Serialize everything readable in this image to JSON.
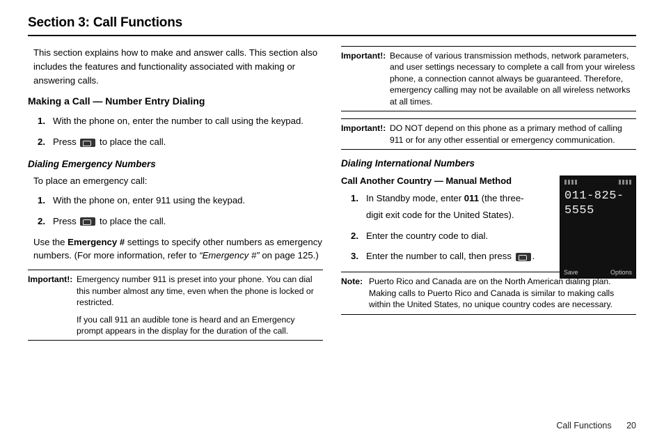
{
  "section_title": "Section 3: Call Functions",
  "intro": "This section explains how to make and answer calls. This section also includes the features and functionality associated with making or answering calls.",
  "left": {
    "h2": "Making a Call — Number Entry Dialing",
    "steps1": [
      "With the phone on, enter the number to call using the keypad.",
      "Press [SEND] to place the call."
    ],
    "h3": "Dialing Emergency Numbers",
    "p1": "To place an emergency call:",
    "steps2": [
      "With the phone on, enter 911 using the keypad.",
      "Press [SEND] to place the call."
    ],
    "p2a": "Use the ",
    "p2b": "Emergency #",
    "p2c": " settings to specify other numbers as emergency numbers. (For more information, refer to ",
    "p2d": "“Emergency #”",
    "p2e": " on page 125.)",
    "note1_label": "Important!:",
    "note1_body": "Emergency number 911 is preset into your phone. You can dial this number almost any time, even when the phone is locked or restricted.",
    "note1_extra": "If you call 911 an audible tone is heard and an Emergency prompt appears in the display for the duration of the call."
  },
  "right": {
    "note2_label": "Important!:",
    "note2_body": "Because of various transmission methods, network parameters, and user settings necessary to complete a call from your wireless phone, a connection cannot always be guaranteed. Therefore, emergency calling may not be available on all wireless networks at all times.",
    "note3_label": "Important!:",
    "note3_body": "DO NOT depend on this phone as a primary method of calling 911 or for any other essential or emergency communication.",
    "h3": "Dialing International Numbers",
    "h4": "Call Another Country — Manual Method",
    "intl_steps": [
      {
        "pre": "In Standby mode, enter ",
        "bold": "011",
        "post": " (the three-digit exit code for the United States)."
      },
      {
        "pre": "Enter the country code to dial.",
        "bold": "",
        "post": ""
      },
      {
        "pre": "Enter the number to call, then press [SEND].",
        "bold": "",
        "post": ""
      }
    ],
    "phone": {
      "line1": "011-825-",
      "line2": "5555",
      "soft_left": "Save",
      "soft_right": "Options"
    },
    "note4_label": "Note:",
    "note4_body": "Puerto Rico and Canada are on the North American dialing plan. Making calls to Puerto Rico and Canada is similar to making calls within the United States, no unique country codes are necessary."
  },
  "footer": {
    "label": "Call Functions",
    "page": "20"
  }
}
